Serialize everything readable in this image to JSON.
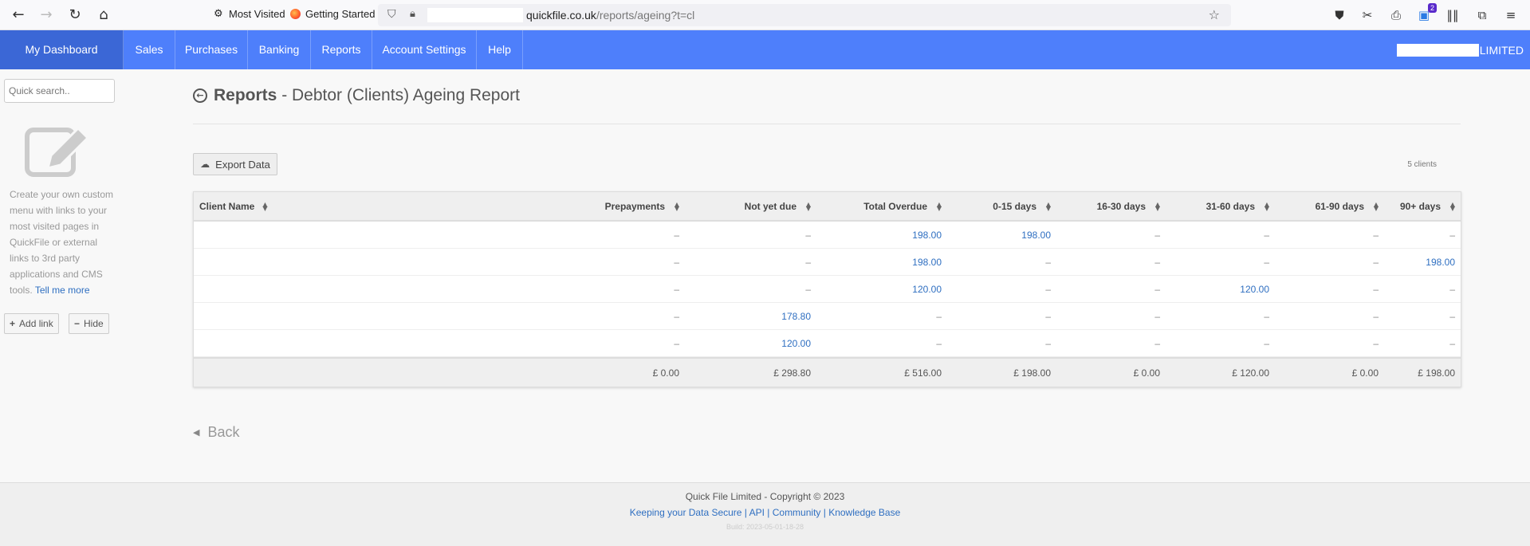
{
  "browser": {
    "bookmarks": [
      {
        "label": "Most Visited",
        "icon": "gear-icon"
      },
      {
        "label": "Getting Started",
        "icon": "firefox-icon"
      }
    ],
    "url_domain": "quickfile.co.uk",
    "url_path": "/reports/ageing?t=cl",
    "extension_badge": "2"
  },
  "nav": {
    "items": [
      "My Dashboard",
      "Sales",
      "Purchases",
      "Banking",
      "Reports",
      "Account Settings",
      "Help"
    ],
    "company_suffix": "LIMITED"
  },
  "sidebar": {
    "search_placeholder": "Quick search..",
    "custom_text": "Create your own custom menu with links to your most visited pages in QuickFile or external links to 3rd party applications and CMS tools.",
    "tell_me_more": "Tell me more",
    "add_link": "Add link",
    "hide": "Hide"
  },
  "page": {
    "title_strong": "Reports",
    "title_rest": " - Debtor (Clients) Ageing Report",
    "export_label": "Export Data",
    "client_count": "5 clients",
    "back_label": "Back"
  },
  "table": {
    "columns": [
      "Client Name",
      "Prepayments",
      "Not yet due",
      "Total Overdue",
      "0-15 days",
      "16-30 days",
      "31-60 days",
      "61-90 days",
      "90+ days"
    ],
    "rows": [
      [
        "",
        "–",
        "–",
        "198.00",
        "198.00",
        "–",
        "–",
        "–",
        "–"
      ],
      [
        "",
        "–",
        "–",
        "198.00",
        "–",
        "–",
        "–",
        "–",
        "198.00"
      ],
      [
        "",
        "–",
        "–",
        "120.00",
        "–",
        "–",
        "120.00",
        "–",
        "–"
      ],
      [
        "",
        "–",
        "178.80",
        "–",
        "–",
        "–",
        "–",
        "–",
        "–"
      ],
      [
        "",
        "–",
        "120.00",
        "–",
        "–",
        "–",
        "–",
        "–",
        "–"
      ]
    ],
    "totals": [
      "",
      "£ 0.00",
      "£ 298.80",
      "£ 516.00",
      "£ 198.00",
      "£ 0.00",
      "£ 120.00",
      "£ 0.00",
      "£ 198.00"
    ]
  },
  "footer": {
    "copyright": "Quick File Limited - Copyright © 2023",
    "links": "Keeping your Data Secure | API | Community | Knowledge Base",
    "build": "Build: 2023-05-01-18-28"
  },
  "colors": {
    "nav_bg": "#4e7ffb",
    "nav_active": "#3b67d6",
    "link": "#2f6fc1"
  }
}
